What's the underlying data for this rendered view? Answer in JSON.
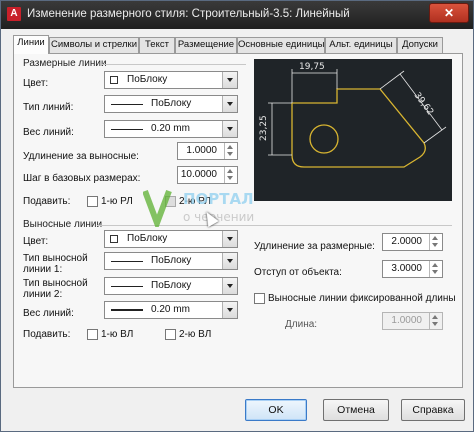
{
  "window": {
    "app_icon_letter": "A",
    "title": "Изменение размерного стиля: Строительный-3.5: Линейный",
    "close_glyph": "✕"
  },
  "tabs": [
    {
      "label": "Линии",
      "active": true
    },
    {
      "label": "Символы и стрелки",
      "active": false
    },
    {
      "label": "Текст",
      "active": false
    },
    {
      "label": "Размещение",
      "active": false
    },
    {
      "label": "Основные единицы",
      "active": false
    },
    {
      "label": "Альт. единицы",
      "active": false
    },
    {
      "label": "Допуски",
      "active": false
    }
  ],
  "dim_lines": {
    "group_title": "Размерные линии",
    "color_label": "Цвет:",
    "color_value": "ПоБлоку",
    "linetype_label": "Тип линий:",
    "linetype_value": "ПоБлоку",
    "lineweight_label": "Вес линий:",
    "lineweight_value": "0.20 mm",
    "extend_label": "Удлинение за выносные:",
    "extend_value": "1.0000",
    "baseline_label": "Шаг в базовых размерах:",
    "baseline_value": "10.0000",
    "suppress_label": "Подавить:",
    "suppress_1": "1-ю РЛ",
    "suppress_2": "2-ю РЛ"
  },
  "ext_lines": {
    "group_title": "Выносные линии",
    "color_label": "Цвет:",
    "color_value": "ПоБлоку",
    "linetype1_label_a": "Тип выносной",
    "linetype1_label_b": "линии 1:",
    "linetype1_value": "ПоБлоку",
    "linetype2_label_a": "Тип выносной",
    "linetype2_label_b": "линии 2:",
    "linetype2_value": "ПоБлоку",
    "lineweight_label": "Вес линий:",
    "lineweight_value": "0.20 mm",
    "suppress_label": "Подавить:",
    "suppress_1": "1-ю ВЛ",
    "suppress_2": "2-ю ВЛ",
    "extend_beyond_label": "Удлинение за размерные:",
    "extend_beyond_value": "2.0000",
    "offset_label": "Отступ от объекта:",
    "offset_value": "3.0000",
    "fixed_length_label": "Выносные линии фиксированной длины",
    "length_label": "Длина:",
    "length_value": "1.0000"
  },
  "preview": {
    "dim_top": "19,75",
    "dim_left": "23,25",
    "dim_right": "39,62"
  },
  "watermark": {
    "text_main": "ПОРТАЛ",
    "text_sub": "о черчении"
  },
  "buttons": {
    "ok": "OK",
    "cancel": "Отмена",
    "help": "Справка"
  },
  "colors": {
    "preview_bg": "#1f2428",
    "preview_geometry": "#d8b531",
    "preview_dim": "#e8e8e8",
    "watermark_green": "#5cb030"
  }
}
